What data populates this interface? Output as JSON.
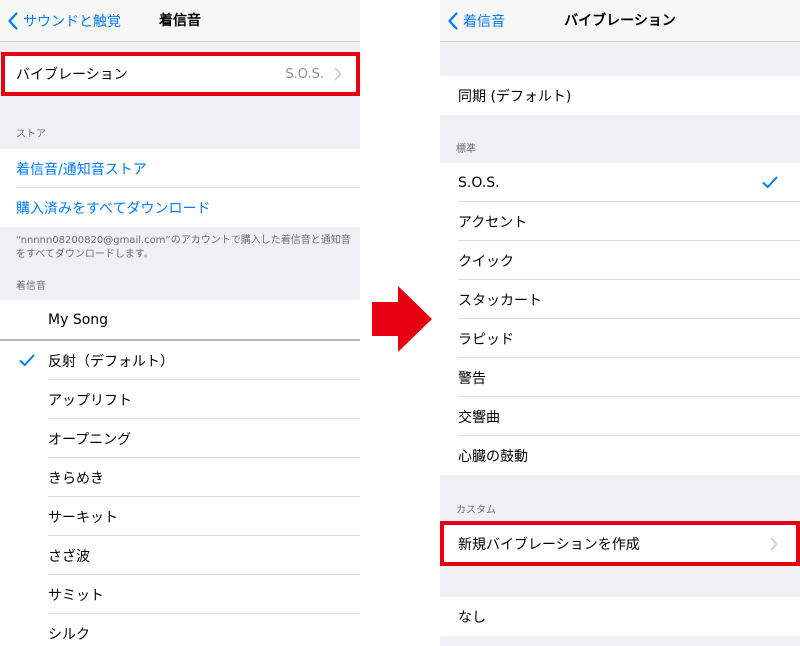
{
  "left_screen": {
    "nav": {
      "back_label": "サウンドと触覚",
      "title": "着信音"
    },
    "vibration_row": {
      "label": "バイブレーション",
      "value": "S.O.S."
    },
    "store_header": "ストア",
    "store_links": [
      "着信音/通知音ストア",
      "購入済みをすべてダウンロード"
    ],
    "store_footer": "“nnnnn08200820@gmail.com”のアカウントで購入した着信音と通知音をすべてダウンロードします。",
    "ringtone_header": "着信音",
    "my_song": "My Song",
    "ringtones": [
      "反射（デフォルト）",
      "アップリフト",
      "オープニング",
      "きらめき",
      "サーキット",
      "さざ波",
      "サミット",
      "シルク"
    ],
    "selected_index": 0
  },
  "right_screen": {
    "nav": {
      "back_label": "着信音",
      "title": "バイブレーション"
    },
    "sync_row": "同期 (デフォルト)",
    "standard_header": "標準",
    "standard_items": [
      "S.O.S.",
      "アクセント",
      "クイック",
      "スタッカート",
      "ラピッド",
      "警告",
      "交響曲",
      "心臓の鼓動"
    ],
    "selected_index": 0,
    "custom_header": "カスタム",
    "create_row": "新規バイブレーションを作成",
    "none_row": "なし"
  },
  "colors": {
    "accent": "#007aff",
    "highlight": "#e60012",
    "background": "#efeff4"
  },
  "icons": [
    "chevron-left-icon",
    "chevron-right-icon",
    "checkmark-icon",
    "arrow-right-icon"
  ]
}
